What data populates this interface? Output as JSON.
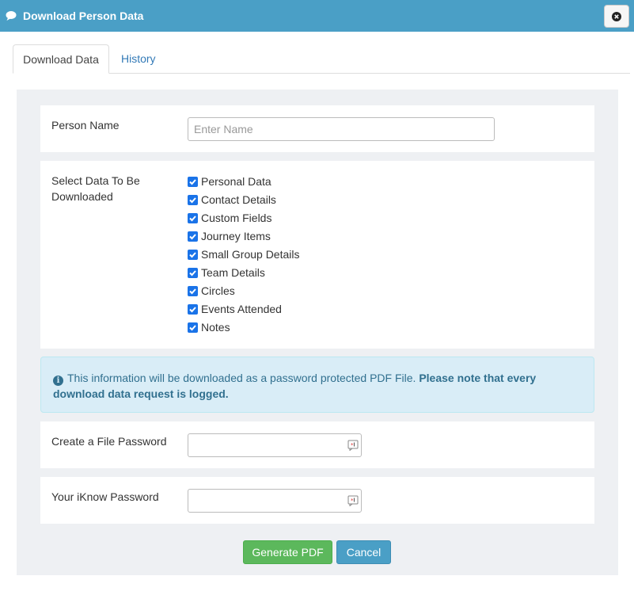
{
  "dialog": {
    "title": "Download Person Data",
    "close_icon": "close-icon",
    "accent_color": "#4a9fc6"
  },
  "tabs": [
    {
      "label": "Download Data",
      "active": true
    },
    {
      "label": "History",
      "active": false
    }
  ],
  "form": {
    "person_name": {
      "label": "Person Name",
      "value": "",
      "placeholder": "Enter Name"
    },
    "select_data": {
      "label": "Select Data To Be Downloaded",
      "items": [
        {
          "label": "Personal Data",
          "checked": true
        },
        {
          "label": "Contact Details",
          "checked": true
        },
        {
          "label": "Custom Fields",
          "checked": true
        },
        {
          "label": "Journey Items",
          "checked": true
        },
        {
          "label": "Small Group Details",
          "checked": true
        },
        {
          "label": "Team Details",
          "checked": true
        },
        {
          "label": "Circles",
          "checked": true
        },
        {
          "label": "Events Attended",
          "checked": true
        },
        {
          "label": "Notes",
          "checked": true
        }
      ]
    },
    "info": {
      "icon": "info-icon",
      "text": "This information will be downloaded as a password protected PDF File.",
      "bold_text": "Please note that every download data request is logged."
    },
    "file_password": {
      "label": "Create a File Password",
      "value": ""
    },
    "iknow_password": {
      "label": "Your iKnow Password",
      "value": ""
    }
  },
  "buttons": {
    "generate": "Generate PDF",
    "cancel": "Cancel"
  }
}
